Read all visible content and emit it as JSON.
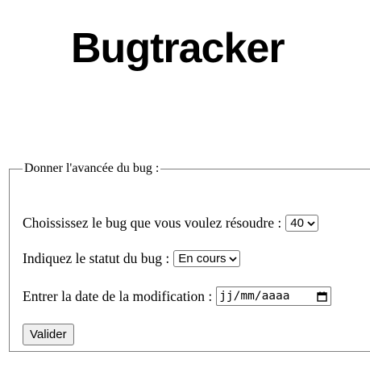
{
  "header": {
    "logo_text": "Bugtracker"
  },
  "form": {
    "legend": "Donner l'avancée du bug :",
    "bug_select": {
      "label": "Choississez le bug que vous voulez résoudre :",
      "selected": "40"
    },
    "status_select": {
      "label": "Indiquez le statut du bug :",
      "selected": "En cours"
    },
    "date_field": {
      "label": "Entrer la date de la modification :",
      "placeholder": "jj/mm/aaaa"
    },
    "submit_label": "Valider"
  },
  "icons": {
    "select_arrow": "chevron-down-icon",
    "date_picker": "calendar-icon"
  }
}
